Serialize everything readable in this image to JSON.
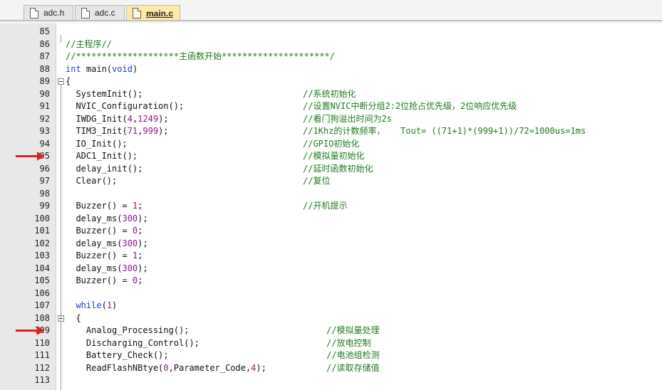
{
  "tabs": [
    {
      "label": "adc.h",
      "active": false
    },
    {
      "label": "adc.c",
      "active": false
    },
    {
      "label": "main.c",
      "active": true
    }
  ],
  "editor": {
    "lines": [
      {
        "num": "85",
        "code": "",
        "comment": ""
      },
      {
        "num": "86",
        "code": "//主程序//",
        "comment": ""
      },
      {
        "num": "87",
        "code": "//********************主函数开始*********************/",
        "comment": ""
      },
      {
        "num": "88",
        "code": "int main(void)",
        "comment": ""
      },
      {
        "num": "89",
        "code": "{",
        "comment": ""
      },
      {
        "num": "90",
        "code": "  SystemInit();",
        "comment": "//系统初始化"
      },
      {
        "num": "91",
        "code": "  NVIC_Configuration();",
        "comment": "//设置NVIC中断分组2:2位抢占优先级，2位响应优先级"
      },
      {
        "num": "92",
        "code": "  IWDG_Init(4,1249);",
        "comment": "//看门狗溢出时间为2s"
      },
      {
        "num": "93",
        "code": "  TIM3_Init(71,999);",
        "comment": "//1Khz的计数频率，   Tout= ((71+1)*(999+1))/72=1000us=1ms"
      },
      {
        "num": "94",
        "code": "  IO_Init();",
        "comment": "//GPIO初始化"
      },
      {
        "num": "95",
        "code": "  ADC1_Init();",
        "comment": "//模拟量初始化"
      },
      {
        "num": "96",
        "code": "  delay_init();",
        "comment": "//延时函数初始化"
      },
      {
        "num": "97",
        "code": "  Clear();",
        "comment": "//复位"
      },
      {
        "num": "98",
        "code": "",
        "comment": ""
      },
      {
        "num": "99",
        "code": "  Buzzer() = 1;",
        "comment": "//开机提示"
      },
      {
        "num": "100",
        "code": "  delay_ms(300);",
        "comment": ""
      },
      {
        "num": "101",
        "code": "  Buzzer() = 0;",
        "comment": ""
      },
      {
        "num": "102",
        "code": "  delay_ms(300);",
        "comment": ""
      },
      {
        "num": "103",
        "code": "  Buzzer() = 1;",
        "comment": ""
      },
      {
        "num": "104",
        "code": "  delay_ms(300);",
        "comment": ""
      },
      {
        "num": "105",
        "code": "  Buzzer() = 0;",
        "comment": ""
      },
      {
        "num": "106",
        "code": "",
        "comment": ""
      },
      {
        "num": "107",
        "code": "  while(1)",
        "comment": ""
      },
      {
        "num": "108",
        "code": "  {",
        "comment": ""
      },
      {
        "num": "109",
        "code": "    Analog_Processing();",
        "comment": "//模拟量处理"
      },
      {
        "num": "110",
        "code": "    Discharging_Control();",
        "comment": "//放电控制"
      },
      {
        "num": "111",
        "code": "    Battery_Check();",
        "comment": "//电池组检测"
      },
      {
        "num": "112",
        "code": "    ReadFlashNBtye(0,Parameter_Code,4);",
        "comment": "//读取存储值"
      },
      {
        "num": "113",
        "code": "",
        "comment": ""
      }
    ],
    "markers": [
      "95",
      "109"
    ],
    "folds": [
      "89",
      "108"
    ]
  },
  "colors": {
    "keyword": "#1a3fc4",
    "comment": "#1f7a1f",
    "number": "#8b1a8b",
    "arrow": "#e02020",
    "active_tab": "#ffe9a6"
  }
}
